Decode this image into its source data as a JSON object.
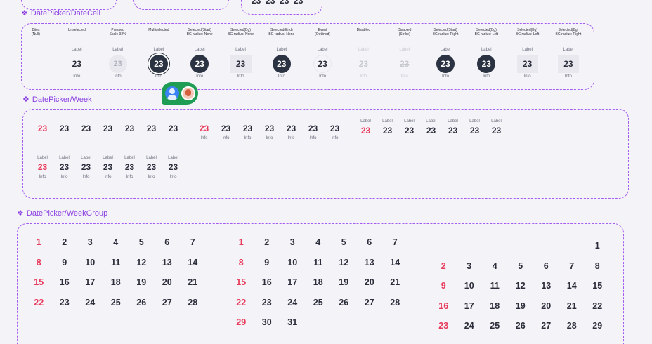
{
  "sections": {
    "datecell": "DatePicker/DateCell",
    "week": "DatePicker/Week",
    "weekgroup": "DatePicker/WeekGroup"
  },
  "datecell": {
    "variants": [
      {
        "name": "Bites\n(Null)",
        "top": "",
        "day": "",
        "info": "",
        "cls": ""
      },
      {
        "name": "Unselected",
        "top": "Label",
        "day": "23",
        "info": "Info",
        "cls": ""
      },
      {
        "name": "Pressed\nScale 92%",
        "top": "Label",
        "day": "23",
        "info": "Info",
        "cls": "v-pressed"
      },
      {
        "name": "Multiselected",
        "top": "Label",
        "day": "23",
        "info": "Info",
        "cls": "v-multi"
      },
      {
        "name": "Selected(Start)\nBG radius: None",
        "top": "Label",
        "day": "23",
        "info": "Info",
        "cls": "v-sel"
      },
      {
        "name": "Selected(Bg)\nBG radius: None",
        "top": "Label",
        "day": "23",
        "info": "Info",
        "cls": "v-bg"
      },
      {
        "name": "Selected(End)\nBG radius: None",
        "top": "Label",
        "day": "23",
        "info": "Info",
        "cls": "v-sel"
      },
      {
        "name": "Event\n(Outlined)",
        "top": "Label",
        "day": "23",
        "info": "Info",
        "cls": "v-outline"
      },
      {
        "name": "Disabled",
        "top": "Label",
        "day": "23",
        "info": "Info",
        "cls": "v-disabled"
      },
      {
        "name": "Disabled\n(Strike)",
        "top": "Label",
        "day": "23",
        "info": "Info",
        "cls": "v-strike"
      },
      {
        "name": "Selected(Start)\nBG radius: Right",
        "top": "Label",
        "day": "23",
        "info": "Info",
        "cls": "v-sel"
      },
      {
        "name": "Selected(Bg)\nBG radius: Left",
        "top": "Label",
        "day": "23",
        "info": "Info",
        "cls": "v-sel"
      },
      {
        "name": "Selected(Bg)\nBG radius: Left",
        "top": "Label",
        "day": "23",
        "info": "Info",
        "cls": "v-bg"
      },
      {
        "name": "Selected(Bg)\nBG radius: Right",
        "top": "Label",
        "day": "23",
        "info": "Info",
        "cls": "v-bg"
      }
    ]
  },
  "week": {
    "rows": [
      {
        "id": "plain",
        "labels": false,
        "infos": false,
        "days": [
          "23",
          "23",
          "23",
          "23",
          "23",
          "23",
          "23"
        ],
        "red_first": true
      },
      {
        "id": "info",
        "labels": false,
        "infos": true,
        "days": [
          "23",
          "23",
          "23",
          "23",
          "23",
          "23",
          "23"
        ],
        "red_first": true
      },
      {
        "id": "label",
        "labels": true,
        "infos": false,
        "days": [
          "23",
          "23",
          "23",
          "23",
          "23",
          "23",
          "23"
        ],
        "red_first": true
      },
      {
        "id": "both",
        "labels": true,
        "infos": true,
        "days": [
          "23",
          "23",
          "23",
          "23",
          "23",
          "23",
          "23"
        ],
        "red_first": true
      }
    ],
    "label_text": "Label",
    "info_text": "Info"
  },
  "weekgroup": {
    "calendars": [
      {
        "id": "cal-a",
        "offset": 0,
        "last": 28
      },
      {
        "id": "cal-b",
        "offset": 0,
        "last": 31
      },
      {
        "id": "cal-c",
        "offset": 6,
        "last": 29
      }
    ]
  },
  "colors": {
    "accent": "#8a3fe0",
    "weekend": "#e83a5a",
    "selected": "#2b3242"
  }
}
